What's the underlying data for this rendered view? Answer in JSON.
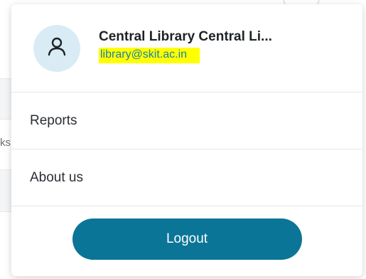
{
  "background": {
    "fragment_text": "ks"
  },
  "profile": {
    "avatar_icon": "user-icon",
    "name": "Central Library Central Li...",
    "email": "library@skit.ac.in"
  },
  "menu": {
    "items": [
      {
        "label": "Reports"
      },
      {
        "label": "About us"
      }
    ],
    "logout_label": "Logout"
  },
  "colors": {
    "accent": "#0b7597",
    "avatar_bg": "#d9ecf5",
    "email_text": "#1b7fb0",
    "email_highlight": "#ffff00"
  }
}
